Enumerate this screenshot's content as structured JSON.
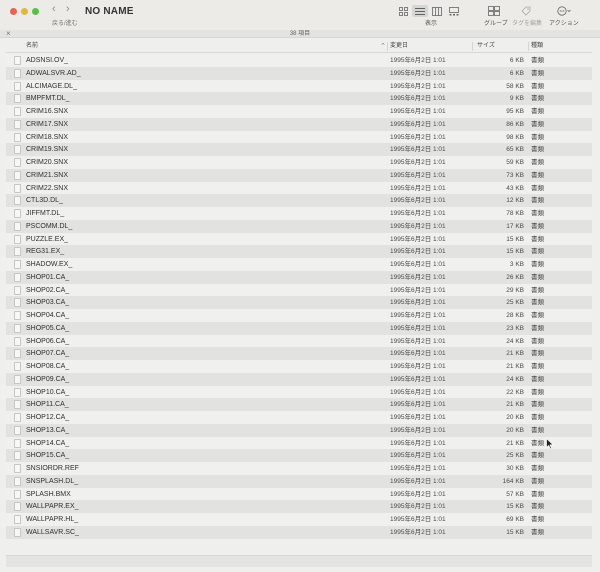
{
  "window": {
    "title": "NO NAME",
    "nav_label": "戻る/進む",
    "view_label": "表示",
    "toolbar": {
      "group_label": "グループ",
      "tag_label": "タグを編集",
      "action_label": "アクション"
    },
    "item_count": "38 項目"
  },
  "columns": {
    "name": "名前",
    "modified": "変更日",
    "size": "サイズ",
    "kind": "種類"
  },
  "files": [
    {
      "name": "ADSNSI.OV_",
      "date": "1995年6月2日 1:01",
      "size": "6 KB",
      "kind": "書類"
    },
    {
      "name": "ADWALSVR.AD_",
      "date": "1995年6月2日 1:01",
      "size": "6 KB",
      "kind": "書類"
    },
    {
      "name": "ALCIMAGE.DL_",
      "date": "1995年6月2日 1:01",
      "size": "58 KB",
      "kind": "書類"
    },
    {
      "name": "BMPFMT.DL_",
      "date": "1995年6月2日 1:01",
      "size": "9 KB",
      "kind": "書類"
    },
    {
      "name": "CRIM16.SNX",
      "date": "1995年6月2日 1:01",
      "size": "95 KB",
      "kind": "書類"
    },
    {
      "name": "CRIM17.SNX",
      "date": "1995年6月2日 1:01",
      "size": "86 KB",
      "kind": "書類"
    },
    {
      "name": "CRIM18.SNX",
      "date": "1995年6月2日 1:01",
      "size": "98 KB",
      "kind": "書類"
    },
    {
      "name": "CRIM19.SNX",
      "date": "1995年6月2日 1:01",
      "size": "65 KB",
      "kind": "書類"
    },
    {
      "name": "CRIM20.SNX",
      "date": "1995年6月2日 1:01",
      "size": "59 KB",
      "kind": "書類"
    },
    {
      "name": "CRIM21.SNX",
      "date": "1995年6月2日 1:01",
      "size": "73 KB",
      "kind": "書類"
    },
    {
      "name": "CRIM22.SNX",
      "date": "1995年6月2日 1:01",
      "size": "43 KB",
      "kind": "書類"
    },
    {
      "name": "CTL3D.DL_",
      "date": "1995年6月2日 1:01",
      "size": "12 KB",
      "kind": "書類"
    },
    {
      "name": "JIFFMT.DL_",
      "date": "1995年6月2日 1:01",
      "size": "78 KB",
      "kind": "書類"
    },
    {
      "name": "PSCOMM.DL_",
      "date": "1995年6月2日 1:01",
      "size": "17 KB",
      "kind": "書類"
    },
    {
      "name": "PUZZLE.EX_",
      "date": "1995年6月2日 1:01",
      "size": "15 KB",
      "kind": "書類"
    },
    {
      "name": "REG31.EX_",
      "date": "1995年6月2日 1:01",
      "size": "15 KB",
      "kind": "書類"
    },
    {
      "name": "SHADOW.EX_",
      "date": "1995年6月2日 1:01",
      "size": "3 KB",
      "kind": "書類"
    },
    {
      "name": "SHOP01.CA_",
      "date": "1995年6月2日 1:01",
      "size": "26 KB",
      "kind": "書類"
    },
    {
      "name": "SHOP02.CA_",
      "date": "1995年6月2日 1:01",
      "size": "29 KB",
      "kind": "書類"
    },
    {
      "name": "SHOP03.CA_",
      "date": "1995年6月2日 1:01",
      "size": "25 KB",
      "kind": "書類"
    },
    {
      "name": "SHOP04.CA_",
      "date": "1995年6月2日 1:01",
      "size": "28 KB",
      "kind": "書類"
    },
    {
      "name": "SHOP05.CA_",
      "date": "1995年6月2日 1:01",
      "size": "23 KB",
      "kind": "書類"
    },
    {
      "name": "SHOP06.CA_",
      "date": "1995年6月2日 1:01",
      "size": "24 KB",
      "kind": "書類"
    },
    {
      "name": "SHOP07.CA_",
      "date": "1995年6月2日 1:01",
      "size": "21 KB",
      "kind": "書類"
    },
    {
      "name": "SHOP08.CA_",
      "date": "1995年6月2日 1:01",
      "size": "21 KB",
      "kind": "書類"
    },
    {
      "name": "SHOP09.CA_",
      "date": "1995年6月2日 1:01",
      "size": "24 KB",
      "kind": "書類"
    },
    {
      "name": "SHOP10.CA_",
      "date": "1995年6月2日 1:01",
      "size": "22 KB",
      "kind": "書類"
    },
    {
      "name": "SHOP11.CA_",
      "date": "1995年6月2日 1:01",
      "size": "21 KB",
      "kind": "書類"
    },
    {
      "name": "SHOP12.CA_",
      "date": "1995年6月2日 1:01",
      "size": "20 KB",
      "kind": "書類"
    },
    {
      "name": "SHOP13.CA_",
      "date": "1995年6月2日 1:01",
      "size": "20 KB",
      "kind": "書類"
    },
    {
      "name": "SHOP14.CA_",
      "date": "1995年6月2日 1:01",
      "size": "21 KB",
      "kind": "書類"
    },
    {
      "name": "SHOP15.CA_",
      "date": "1995年6月2日 1:01",
      "size": "25 KB",
      "kind": "書類"
    },
    {
      "name": "SNSIORDR.REF",
      "date": "1995年6月2日 1:01",
      "size": "30 KB",
      "kind": "書類"
    },
    {
      "name": "SNSPLASH.DL_",
      "date": "1995年6月2日 1:01",
      "size": "164 KB",
      "kind": "書類"
    },
    {
      "name": "SPLASH.BMX",
      "date": "1995年6月2日 1:01",
      "size": "57 KB",
      "kind": "書類"
    },
    {
      "name": "WALLPAPR.EX_",
      "date": "1995年6月2日 1:01",
      "size": "15 KB",
      "kind": "書類"
    },
    {
      "name": "WALLPAPR.HL_",
      "date": "1995年6月2日 1:01",
      "size": "69 KB",
      "kind": "書類"
    },
    {
      "name": "WALLSAVR.SC_",
      "date": "1995年6月2日 1:01",
      "size": "15 KB",
      "kind": "書類"
    }
  ]
}
